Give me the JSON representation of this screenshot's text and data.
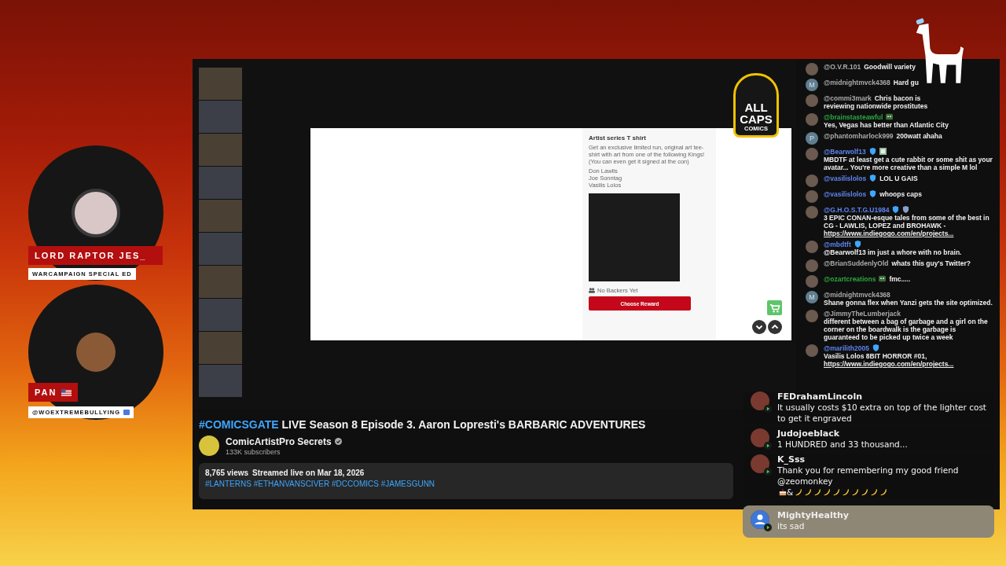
{
  "guests": [
    {
      "name": "LORD RAPTOR JES_",
      "flag_icon": false,
      "handle": "WARCAMPAIGN SPECIAL ED",
      "handle_badge": false
    },
    {
      "name": "PAN",
      "flag_icon": true,
      "handle": "@WOEXTREMEBULLYING",
      "handle_badge": true
    }
  ],
  "participants": [
    {
      "kind": "webcam"
    },
    {
      "kind": "webcam"
    },
    {
      "kind": "webcam"
    },
    {
      "kind": "webcam"
    },
    {
      "kind": "webcam"
    },
    {
      "kind": "webcam"
    },
    {
      "kind": "webcam"
    },
    {
      "kind": "webcam"
    },
    {
      "kind": "webcam"
    },
    {
      "kind": "webcam"
    }
  ],
  "logo": {
    "line_1": "ALL",
    "line_2": "CAPS",
    "line_3": "COMICS"
  },
  "reward": {
    "title": "Artist series T shirt",
    "description": "Get an exclusive limited run, original art tee-shirt with art from one of the following Kings! (You can even get it signed at the con)",
    "artists": [
      "Don Lawlis",
      "Joe Sonntag",
      "Vasilis Lolos"
    ],
    "backers": "No Backers Yet",
    "button": "Choose Reward"
  },
  "video": {
    "title_tag": "#COMICSGATE",
    "title": "LIVE Season 8 Episode 3. Aaron Lopresti's BARBARIC ADVENTURES",
    "channel": "ComicArtistPro Secrets",
    "subscribers": "133K subscribers",
    "views": "8,765 views",
    "streamed": "Streamed live on Mar 18, 2026",
    "hashtags": "#LANTERNS #ETHANVANSCIVER #DCCOMICS #JAMESGUNN"
  },
  "chat": [
    {
      "avatar": {
        "kind": "photo"
      },
      "author": "@O.V.R.101",
      "color": "#aaaaaa",
      "text": "Goodwill variety"
    },
    {
      "avatar": {
        "kind": "letter",
        "letter": "M"
      },
      "author": "@midnightmvck4368",
      "color": "#aaaaaa",
      "text": "Hard gu"
    },
    {
      "avatar": {
        "kind": "photo"
      },
      "author": "@commi3mark",
      "color": "#aaaaaa",
      "text": "Chris bacon is",
      "continued": "reviewing nationwide prostitutes"
    },
    {
      "avatar": {
        "kind": "photo"
      },
      "author": "@brainstasteawful",
      "color": "#2ba640",
      "badges": [
        {
          "kind": "member"
        }
      ],
      "text": "Yes, Vegas has better than Atlantic City"
    },
    {
      "avatar": {
        "kind": "letter",
        "letter": "P"
      },
      "author": "@phantomharlock999",
      "color": "#aaaaaa",
      "text": "200watt ahaha"
    },
    {
      "avatar": {
        "kind": "photo"
      },
      "author": "@Bearwolf13",
      "color": "#5e84f1",
      "badges": [
        {
          "kind": "verified"
        },
        {
          "kind": "sticker"
        }
      ],
      "text": "MBDTF at least get a cute rabbit or some shit as your avatar... You're more creative than a simple M lol"
    },
    {
      "avatar": {
        "kind": "photo"
      },
      "author": "@vasilislolos",
      "color": "#5e84f1",
      "badges": [
        {
          "kind": "verified"
        }
      ],
      "text": "LOL U GAIS"
    },
    {
      "avatar": {
        "kind": "photo"
      },
      "author": "@vasilislolos",
      "color": "#5e84f1",
      "badges": [
        {
          "kind": "verified"
        }
      ],
      "text": "whoops caps"
    },
    {
      "avatar": {
        "kind": "photo"
      },
      "author": "@G.H.O.S.T.G.U1984",
      "color": "#5e84f1",
      "badges": [
        {
          "kind": "verified"
        },
        {
          "kind": "shield"
        }
      ],
      "text": "3 EPIC CONAN-esque tales from some of the best in CG - LAWLIS, LOPEZ and BROHAWK -",
      "link": "https://www.indiegogo.com/en/projects..."
    },
    {
      "avatar": {
        "kind": "photo"
      },
      "author": "@mbdtft",
      "color": "#5e84f1",
      "badges": [
        {
          "kind": "verified"
        }
      ],
      "text": "@Bearwolf13 im just a whore with no brain."
    },
    {
      "avatar": {
        "kind": "photo"
      },
      "author": "@BrianSuddenlyOld",
      "color": "#aaaaaa",
      "text": "whats this guy's Twitter?"
    },
    {
      "avatar": {
        "kind": "photo"
      },
      "author": "@ozartcreations",
      "color": "#2ba640",
      "badges": [
        {
          "kind": "member"
        }
      ],
      "text": "fmc....."
    },
    {
      "avatar": {
        "kind": "letter",
        "letter": "M"
      },
      "author": "@midnightmvck4368",
      "color": "#aaaaaa",
      "text": "Shane gonna flex when Yanzi gets the site optimized."
    },
    {
      "avatar": {
        "kind": "photo"
      },
      "author": "@JimmyTheLumberjack",
      "color": "#aaaaaa",
      "text": "different between a bag of garbage and a girl on the corner on the boardwalk is the garbage is guaranteed to be picked up twice a week"
    },
    {
      "avatar": {
        "kind": "photo"
      },
      "author": "@marilith2005",
      "color": "#5e84f1",
      "badges": [
        {
          "kind": "verified"
        }
      ],
      "text": "Vasilis Lolos 8BIT HORROR #01,",
      "link": "https://www.indiegogo.com/en/projects..."
    }
  ],
  "overlay_chat": [
    {
      "avatar": {
        "kind": "photo"
      },
      "author": "FEDrahamLincoln",
      "highlighted": false,
      "parts": [
        {
          "kind": "text",
          "text": "It usually costs $10 extra on top of the lighter cost to get it engraved"
        }
      ]
    },
    {
      "avatar": {
        "kind": "photo"
      },
      "author": "Judojoeblack",
      "highlighted": false,
      "parts": [
        {
          "kind": "text",
          "text": "1 HUNDRED and 33 thousand..."
        }
      ]
    },
    {
      "avatar": {
        "kind": "photo"
      },
      "author": "K_Sss",
      "highlighted": false,
      "parts": [
        {
          "kind": "text",
          "text": "Thank you for remembering my good friend @zeomonkey"
        },
        {
          "kind": "cake"
        },
        {
          "kind": "text",
          "text": "&"
        },
        {
          "kind": "banana"
        },
        {
          "kind": "banana"
        },
        {
          "kind": "banana"
        },
        {
          "kind": "banana"
        },
        {
          "kind": "banana"
        },
        {
          "kind": "banana"
        },
        {
          "kind": "banana"
        },
        {
          "kind": "banana"
        },
        {
          "kind": "banana"
        },
        {
          "kind": "banana"
        }
      ]
    },
    {
      "avatar": {
        "kind": "default"
      },
      "author": "MightyHealthy",
      "highlighted": true,
      "parts": [
        {
          "kind": "text",
          "text": "its sad"
        }
      ]
    }
  ]
}
